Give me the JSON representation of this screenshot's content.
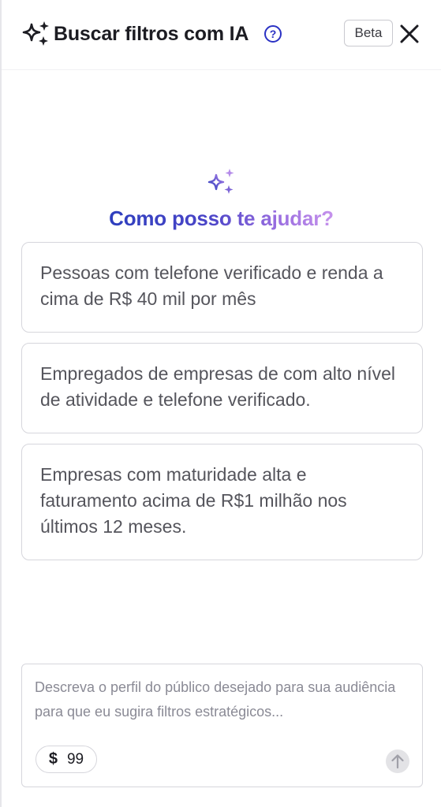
{
  "header": {
    "title": "Buscar filtros com IA",
    "help_icon": "question-circle-icon",
    "badge": "Beta",
    "close_icon": "close-icon"
  },
  "hero": {
    "icon": "sparkles-icon",
    "title": "Como posso te ajudar?"
  },
  "suggestions": [
    {
      "text": "Pessoas com telefone verificado e renda a cima de R$ 40 mil por mês"
    },
    {
      "text": "Empregados de empresas de com alto nível de atividade e telefone verificado."
    },
    {
      "text": "Empresas com maturidade alta e faturamento acima de R$1 milhão nos últimos 12 meses."
    }
  ],
  "composer": {
    "placeholder": "Descreva o perfil do público desejado para sua audiência para que eu sugira filtros estratégicos...",
    "value": "",
    "credits_symbol": "$",
    "credits_value": "99",
    "send_icon": "arrow-up-icon"
  },
  "colors": {
    "accent_blue": "#2b32c4",
    "gradient_start": "#2e3fbe",
    "gradient_end": "#c692ec",
    "border": "#d6d6dc"
  }
}
